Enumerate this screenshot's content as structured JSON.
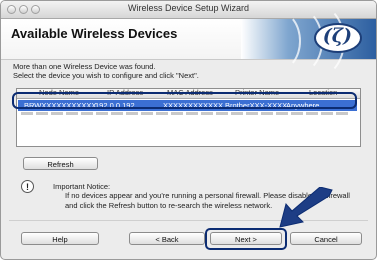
{
  "window": {
    "title": "Wireless Device Setup Wizard"
  },
  "header": {
    "title": "Available Wireless Devices",
    "logo_text": "(ζ)"
  },
  "instructions": {
    "line1": "More than one Wireless Device was found.",
    "line2": "Select the device you wish to configure and click \"Next\"."
  },
  "table": {
    "columns": [
      "Node Name",
      "IP Address",
      "MAC Address",
      "Printer Name",
      "Location"
    ],
    "rows": [
      {
        "node_name": "BRWXXXXXXXXXXX",
        "ip": "192.0.0.192",
        "mac": "XXXXXXXXXXXX",
        "printer": "BrotherXXX-XXXX",
        "location": "Anywhere",
        "selected": true
      }
    ]
  },
  "buttons": {
    "refresh": "Refresh",
    "help": "Help",
    "back": "< Back",
    "next": "Next >",
    "cancel": "Cancel"
  },
  "notice": {
    "icon": "warning-icon",
    "title": "Important Notice:",
    "line1": "If no devices appear and you're running a personal firewall. Please disable the firewall",
    "line2": "and click the Refresh button to re-search the wireless network."
  },
  "colors": {
    "selection": "#3b6fd3",
    "highlight": "#0c2c72"
  }
}
